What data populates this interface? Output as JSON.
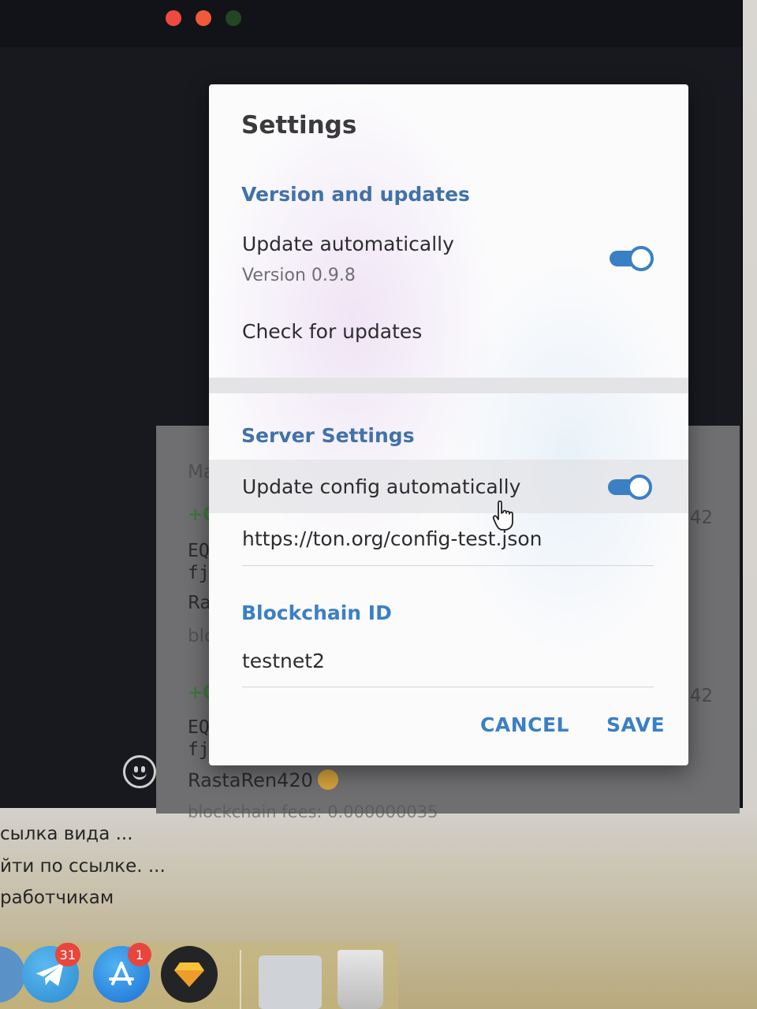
{
  "dialog": {
    "title": "Settings",
    "version_section": {
      "heading": "Version and updates",
      "update_auto_label": "Update automatically",
      "version_text": "Version 0.9.8",
      "update_auto_on": true,
      "check_updates_label": "Check for updates"
    },
    "server_section": {
      "heading": "Server Settings",
      "update_config_label": "Update config automatically",
      "update_config_on": true,
      "config_url": "https://ton.org/config-test.json"
    },
    "blockchain_section": {
      "heading": "Blockchain ID",
      "value": "testnet2"
    },
    "buttons": {
      "cancel": "CANCEL",
      "save": "SAVE"
    }
  },
  "background_chat": {
    "lines": [
      "Ma",
      "+0",
      "EQ",
      "fj",
      "Ra",
      "blc",
      "+0",
      "EQ",
      "fj"
    ],
    "times": [
      "42",
      "42"
    ],
    "user": "RastaRen420",
    "fee_partial": "blockchain fees: 0.000000035"
  },
  "chat_list_snippets": [
    "сылка вида ...",
    "йти по ссылке. ...",
    "работчикам"
  ],
  "dock": {
    "telegram_badge": "31",
    "appstore_badge": "1"
  },
  "colors": {
    "accent": "#3b80c4",
    "section_heading": "#4172a8",
    "dialog_bg": "#fbfbfc",
    "window_bg": "#17191f"
  }
}
